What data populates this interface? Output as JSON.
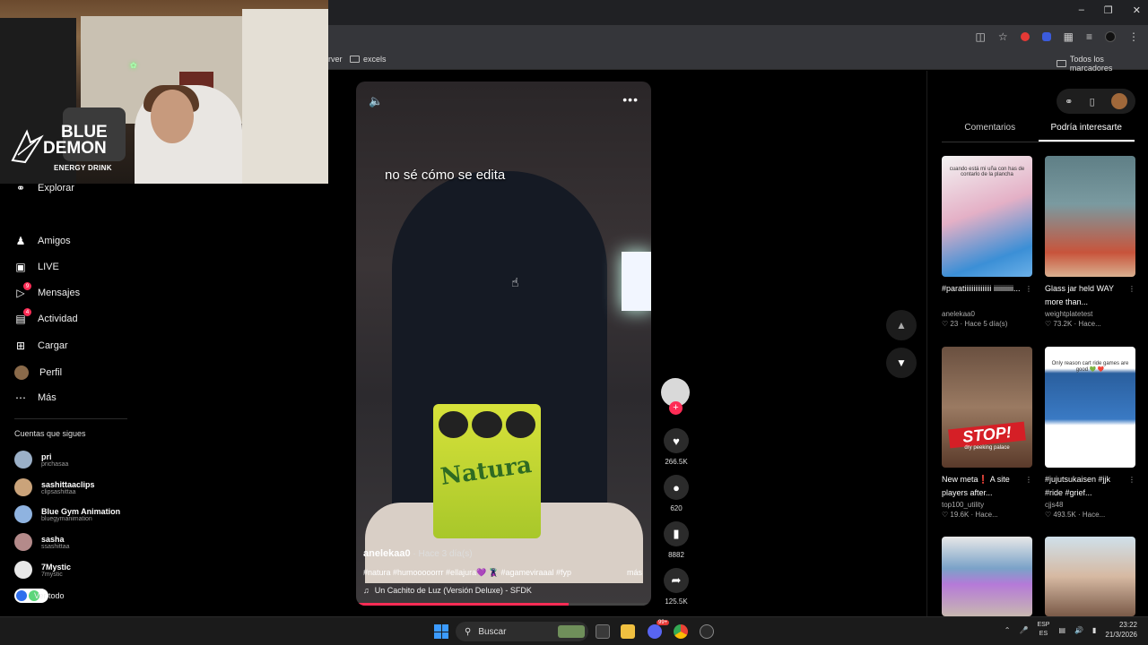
{
  "browser": {
    "bookmarks": [
      {
        "label": "rver"
      },
      {
        "label": "excels"
      }
    ],
    "bookmarks_right": "Todos los marcadores"
  },
  "overlay": {
    "brand_line1": "BLUE",
    "brand_line2": "DEMON",
    "brand_line3": "ENERGY DRINK"
  },
  "sidebar": {
    "items": [
      {
        "label": "Explorar",
        "icon": "compass-icon"
      },
      {
        "label": "Amigos",
        "icon": "friends-icon"
      },
      {
        "label": "LIVE",
        "icon": "live-icon"
      },
      {
        "label": "Mensajes",
        "icon": "messages-icon",
        "badge": "9"
      },
      {
        "label": "Actividad",
        "icon": "activity-icon",
        "badge": "4"
      },
      {
        "label": "Cargar",
        "icon": "upload-icon"
      },
      {
        "label": "Perfil",
        "icon": "profile-avatar"
      },
      {
        "label": "Más",
        "icon": "more-icon"
      }
    ],
    "following_title": "Cuentas que sigues",
    "accounts": [
      {
        "name": "pri",
        "handle": "prichasaa",
        "color": "#9bb0c8"
      },
      {
        "name": "sashittaaclips",
        "handle": "clipsashittaa",
        "color": "#caa37a"
      },
      {
        "name": "Blue Gym Animation",
        "handle": "bluegymanimation",
        "color": "#8fb3e0"
      },
      {
        "name": "sasha",
        "handle": "ssashittaa",
        "color": "#b48a8a"
      },
      {
        "name": "7Mystic",
        "handle": "7mystic",
        "color": "#e8e8e8"
      }
    ],
    "see_all": "Ver todo"
  },
  "video": {
    "overlay_text": "no sé cómo se edita",
    "bag_label": "Natura",
    "author": "anelekaa0",
    "time": " · Hace 3 día(s)",
    "description": "#natura #humooooorrr #ellajura💜 🦹 #agameviraaal #fyp",
    "more": "más",
    "music": "Un Cachito de Luz (Versión Deluxe) - SFDK",
    "progress": 0.72,
    "likes": "266.5K",
    "comments": "620",
    "saves": "8882",
    "shares": "125.5K"
  },
  "right_panel": {
    "tabs": [
      {
        "label": "Comentarios",
        "active": false
      },
      {
        "label": "Podría interesarte",
        "active": true
      }
    ],
    "cards": [
      {
        "caption": "#paratiiiiiiiiiiiiiii iiiiiiiiiii...",
        "user": "anelekaa0",
        "likes": "23",
        "time": "Hace 5 día(s)",
        "thumb_text": "cuando está mi uña con has de contarlo de la plancha",
        "bg": "linear-gradient(160deg,#f3f3f3 0%,#e4b0c6 45%,#3b8fd6 80%,#6bb0e8 100%)"
      },
      {
        "caption": "Glass jar held WAY more than...",
        "user": "weightplatetest",
        "likes": "73.2K",
        "time": "Hace...",
        "thumb_text": "",
        "bg": "linear-gradient(180deg,#5f7f86 0%,#7a9aa0 40%,#c8543b 80%,#d9b090 100%)"
      },
      {
        "caption": "New meta❗ A site players after...",
        "user": "top100_utility",
        "likes": "19.6K",
        "time": "Hace...",
        "thumb_text": "",
        "bg": "linear-gradient(180deg,#6a5040 0%,#9a7a62 50%,#5a3a2a 100%)"
      },
      {
        "caption": "#jujutsukaisen #jjk #ride #grief...",
        "user": "cjjs48",
        "likes": "493.5K",
        "time": "Hace...",
        "thumb_text": "Only reason cart ride games are good 💚 ❤️",
        "bg": "linear-gradient(180deg,#ffffff 0%,#ffffff 18%,#2a5f9e 22%,#3a7ac4 60%,#ffffff 65%,#ffffff 100%)"
      },
      {
        "caption": "",
        "user": "",
        "likes": "",
        "time": "",
        "thumb_text": "",
        "bg": "linear-gradient(180deg,#e8e8e8 0%,#7aa2c8 40%,#b57ad8 60%,#c8b8b0 100%)"
      },
      {
        "caption": "",
        "user": "",
        "likes": "",
        "time": "",
        "thumb_text": "",
        "bg": "linear-gradient(180deg,#cfe0ea 0%,#d6b9a2 50%,#7a5a48 100%)"
      }
    ],
    "stop_text": "STOP!",
    "stop_sub": "dry peeking palace"
  },
  "taskbar": {
    "search_label": "Buscar",
    "lang_top": "ESP",
    "lang_bottom": "ES",
    "time": "23:22",
    "date": "21/3/2026",
    "discord_badge": "99+"
  }
}
